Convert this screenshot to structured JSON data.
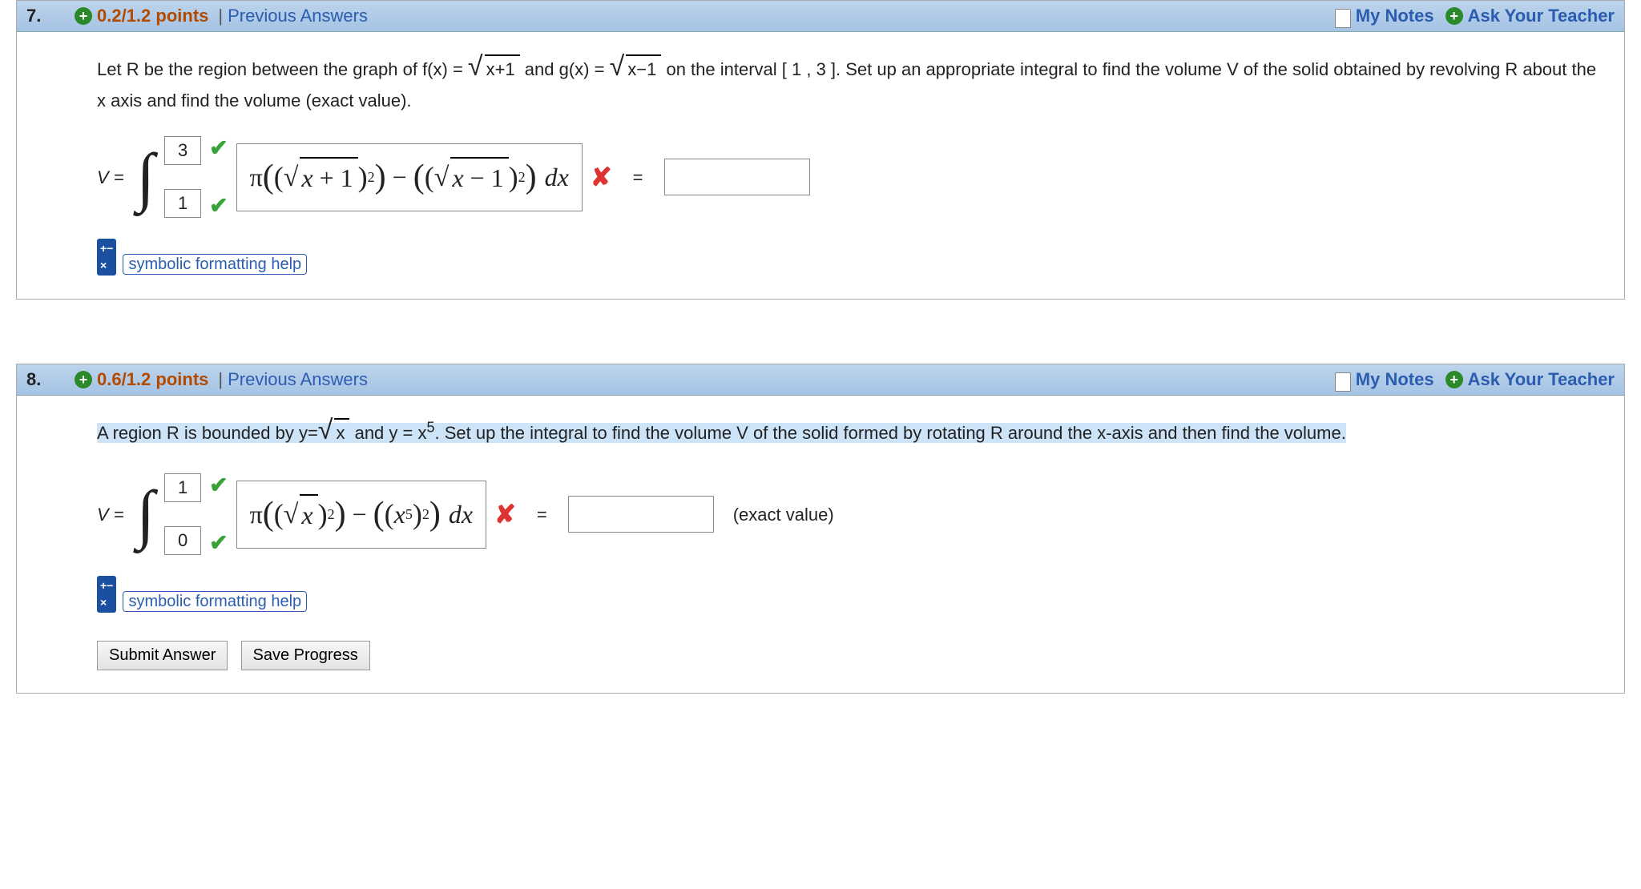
{
  "q7": {
    "number": "7.",
    "points": "0.2/1.2 points",
    "prev": "Previous Answers",
    "my_notes": "My Notes",
    "ask": "Ask Your Teacher",
    "prompt_a": "Let R be the region between the graph of  f(x) = ",
    "sqrt1_pre": "√",
    "sqrt1_arg": "x+1",
    "prompt_b": "  and  g(x) = ",
    "sqrt2_pre": "√",
    "sqrt2_arg": "x−1",
    "prompt_c": "   on the interval [ 1 , 3 ]. Set up an appropriate integral to find the volume V of the solid obtained by revolving R about the x axis and find the volume (exact value).",
    "V_eq": "V =",
    "upper": "3",
    "lower": "1",
    "integrand_html": "π( ( √(x+1) )² ) − ( ( √(x−1) )² ) dx",
    "eq": "=",
    "sym_help": "symbolic formatting help"
  },
  "q8": {
    "number": "8.",
    "points": "0.6/1.2 points",
    "prev": "Previous Answers",
    "my_notes": "My Notes",
    "ask": "Ask Your Teacher",
    "prompt_a": "A region R is bounded by y=",
    "sqrt_pre": "√",
    "sqrt_arg": "x",
    "prompt_b": " and y = x",
    "exp": "5",
    "prompt_c": ". Set up the integral to find the volume V of the solid formed by rotating R around the x-axis and then find the volume.",
    "V_eq": "V =",
    "upper": "1",
    "lower": "0",
    "eq": "=",
    "exact": "(exact value)",
    "sym_help": "symbolic formatting help",
    "submit": "Submit Answer",
    "save": "Save Progress"
  },
  "icons": {
    "check": "✔",
    "cross": "✘",
    "plus": "+"
  }
}
